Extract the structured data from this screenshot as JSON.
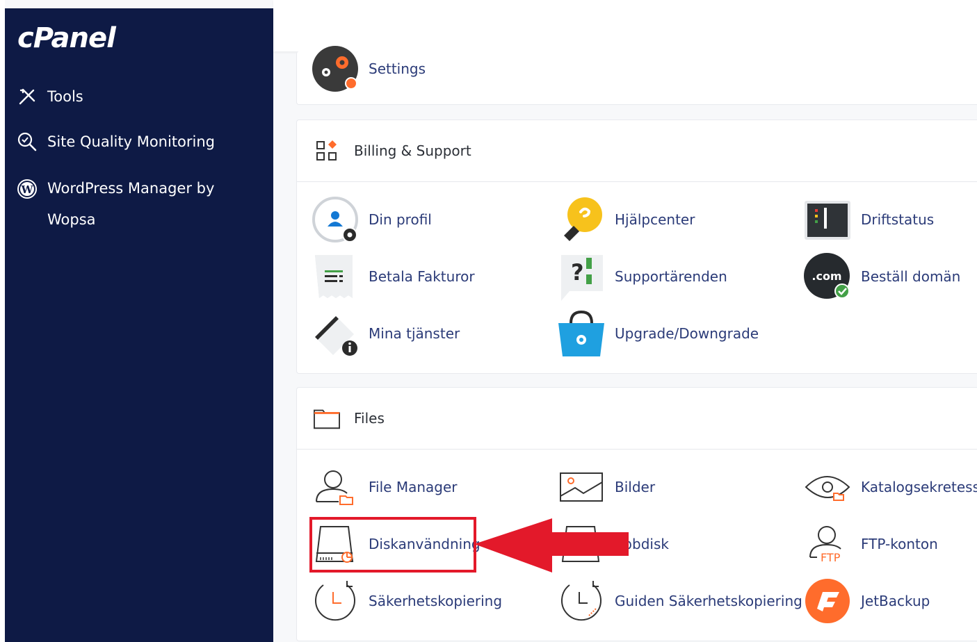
{
  "app": {
    "logo": "cPanel"
  },
  "sidebar": {
    "items": [
      {
        "label": "Tools",
        "icon": "tools-icon"
      },
      {
        "label": "Site Quality Monitoring",
        "icon": "magnifier-check-icon"
      },
      {
        "label": "WordPress Manager by Wopsa",
        "icon": "wordpress-icon"
      }
    ]
  },
  "settings_card": {
    "label": "Settings"
  },
  "billing": {
    "title": "Billing & Support",
    "tools": [
      {
        "label": "Din profil"
      },
      {
        "label": "Hjälpcenter"
      },
      {
        "label": "Driftstatus"
      },
      {
        "label": "Betala Fakturor"
      },
      {
        "label": "Supportärenden"
      },
      {
        "label": "Beställ domän"
      },
      {
        "label": "Mina tjänster"
      },
      {
        "label": "Upgrade/Downgrade"
      }
    ],
    "com_badge": ".com"
  },
  "files": {
    "title": "Files",
    "tools": [
      {
        "label": "File Manager"
      },
      {
        "label": "Bilder"
      },
      {
        "label": "Katalogsekretess"
      },
      {
        "label": "Diskanvändning"
      },
      {
        "label": "ebbdisk"
      },
      {
        "label": "FTP-konton"
      },
      {
        "label": "Säkerhetskopiering"
      },
      {
        "label": "Guiden Säkerhetskopiering"
      },
      {
        "label": "JetBackup"
      }
    ],
    "ftp_text": "FTP"
  },
  "colors": {
    "sidebar": "#0e1a45",
    "link": "#2b3b78",
    "accent_orange": "#ff6c2c",
    "highlight_red": "#e3192a"
  }
}
